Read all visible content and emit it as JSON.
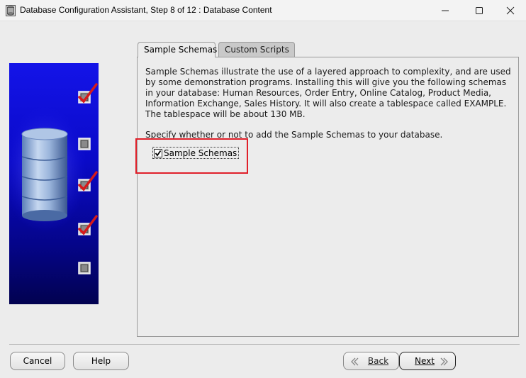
{
  "window": {
    "title": "Database Configuration Assistant, Step 8 of 12 : Database Content",
    "icons": [
      "database-app-icon",
      "minimize-icon",
      "maximize-icon",
      "close-icon"
    ]
  },
  "side_panel": {
    "steps": [
      {
        "state": "checked"
      },
      {
        "state": "unchecked"
      },
      {
        "state": "checked"
      },
      {
        "state": "checked"
      },
      {
        "state": "unchecked"
      }
    ],
    "colors": {
      "gradient_top": "#1414e8",
      "gradient_bottom": "#020250",
      "check_mark": "#d61a1a"
    }
  },
  "tabs": [
    {
      "label": "Sample Schemas",
      "active": true
    },
    {
      "label": "Custom Scripts",
      "active": false
    }
  ],
  "content": {
    "description": "Sample Schemas illustrate the use of a layered approach to complexity, and are used by some demonstration programs. Installing this will give you the following schemas in your database: Human Resources, Order Entry, Online Catalog, Product Media, Information Exchange, Sales History. It will also create a tablespace called EXAMPLE. The tablespace will be about 130 MB.",
    "prompt": "Specify whether or not to add the Sample Schemas to your database.",
    "checkbox": {
      "label": "Sample Schemas",
      "checked": true
    },
    "highlight_color": "#e0202a"
  },
  "buttons": {
    "cancel": "Cancel",
    "help": "Help",
    "back": "Back",
    "next": "Next"
  }
}
